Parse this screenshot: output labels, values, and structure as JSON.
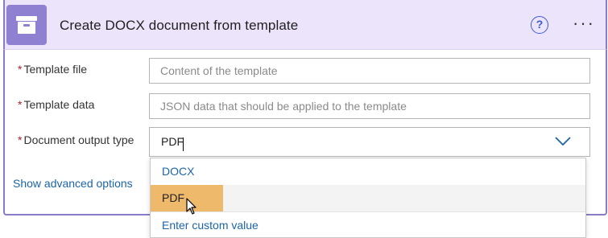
{
  "header": {
    "title": "Create DOCX document from template",
    "app_icon": "archive-drawer-icon",
    "help_symbol": "?",
    "more_symbol": "···",
    "accent_color": "#8f80d2"
  },
  "fields": {
    "template_file": {
      "label": "Template file",
      "placeholder": "Content of the template"
    },
    "template_data": {
      "label": "Template data",
      "placeholder": "JSON data that should be applied to the template"
    },
    "document_output_type": {
      "label": "Document output type",
      "value": "PDF"
    }
  },
  "required_mark": "*",
  "advanced_link": "Show advanced options",
  "dropdown": {
    "options": [
      "DOCX",
      "PDF"
    ],
    "highlighted": "PDF",
    "custom_value_label": "Enter custom value"
  }
}
